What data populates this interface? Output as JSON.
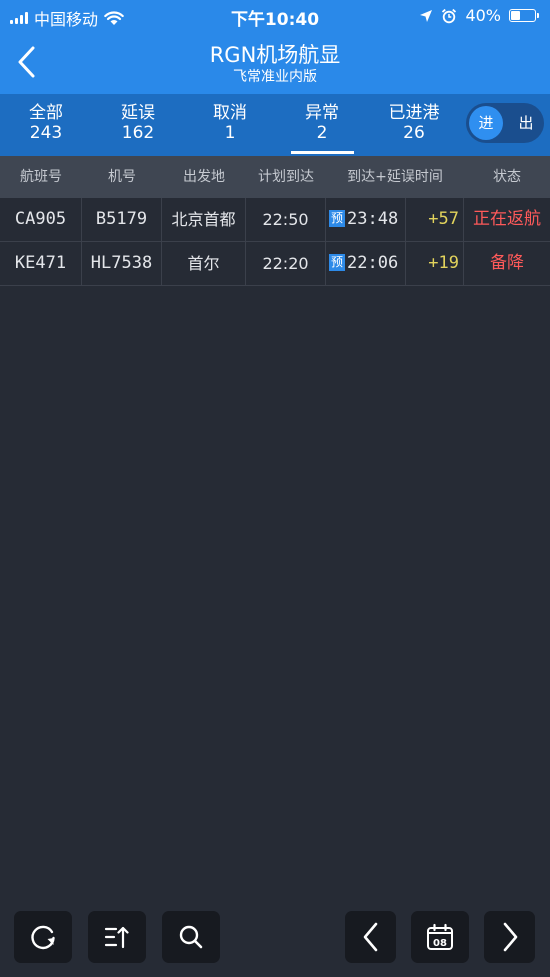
{
  "status_bar": {
    "carrier": "中国移动",
    "time": "下午10:40",
    "battery_text": "40%",
    "battery_level": 0.4
  },
  "nav": {
    "title": "RGN机场航显",
    "subtitle": "飞常准业内版"
  },
  "tabs": [
    {
      "label": "全部",
      "count": "243"
    },
    {
      "label": "延误",
      "count": "162"
    },
    {
      "label": "取消",
      "count": "1"
    },
    {
      "label": "异常",
      "count": "2",
      "active": true
    },
    {
      "label": "已进港",
      "count": "26"
    }
  ],
  "direction_toggle": {
    "in_label": "进",
    "out_label": "出",
    "selected": "in"
  },
  "table": {
    "columns": [
      "航班号",
      "机号",
      "出发地",
      "计划到达",
      "到达+延误时间",
      "状态"
    ],
    "rows": [
      {
        "flight": "CA905",
        "reg": "B5179",
        "origin": "北京首都",
        "planned": "22:50",
        "eta_badge": "预",
        "eta": "23:48",
        "delay": "+57",
        "status": "正在返航"
      },
      {
        "flight": "KE471",
        "reg": "HL7538",
        "origin": "首尔",
        "planned": "22:20",
        "eta_badge": "预",
        "eta": "22:06",
        "delay": "+19",
        "status": "备降"
      }
    ]
  },
  "toolbar": {
    "calendar_day": "08",
    "buttons": [
      "refresh-icon",
      "sort-icon",
      "search-icon",
      "chevron-left-icon",
      "calendar-icon",
      "chevron-right-icon"
    ]
  },
  "colors": {
    "header_blue": "#2a89e9",
    "tabs_blue": "#1d6dc1",
    "background": "#262b35",
    "delay_yellow": "#e2d35c",
    "status_red": "#ff5a5a"
  }
}
